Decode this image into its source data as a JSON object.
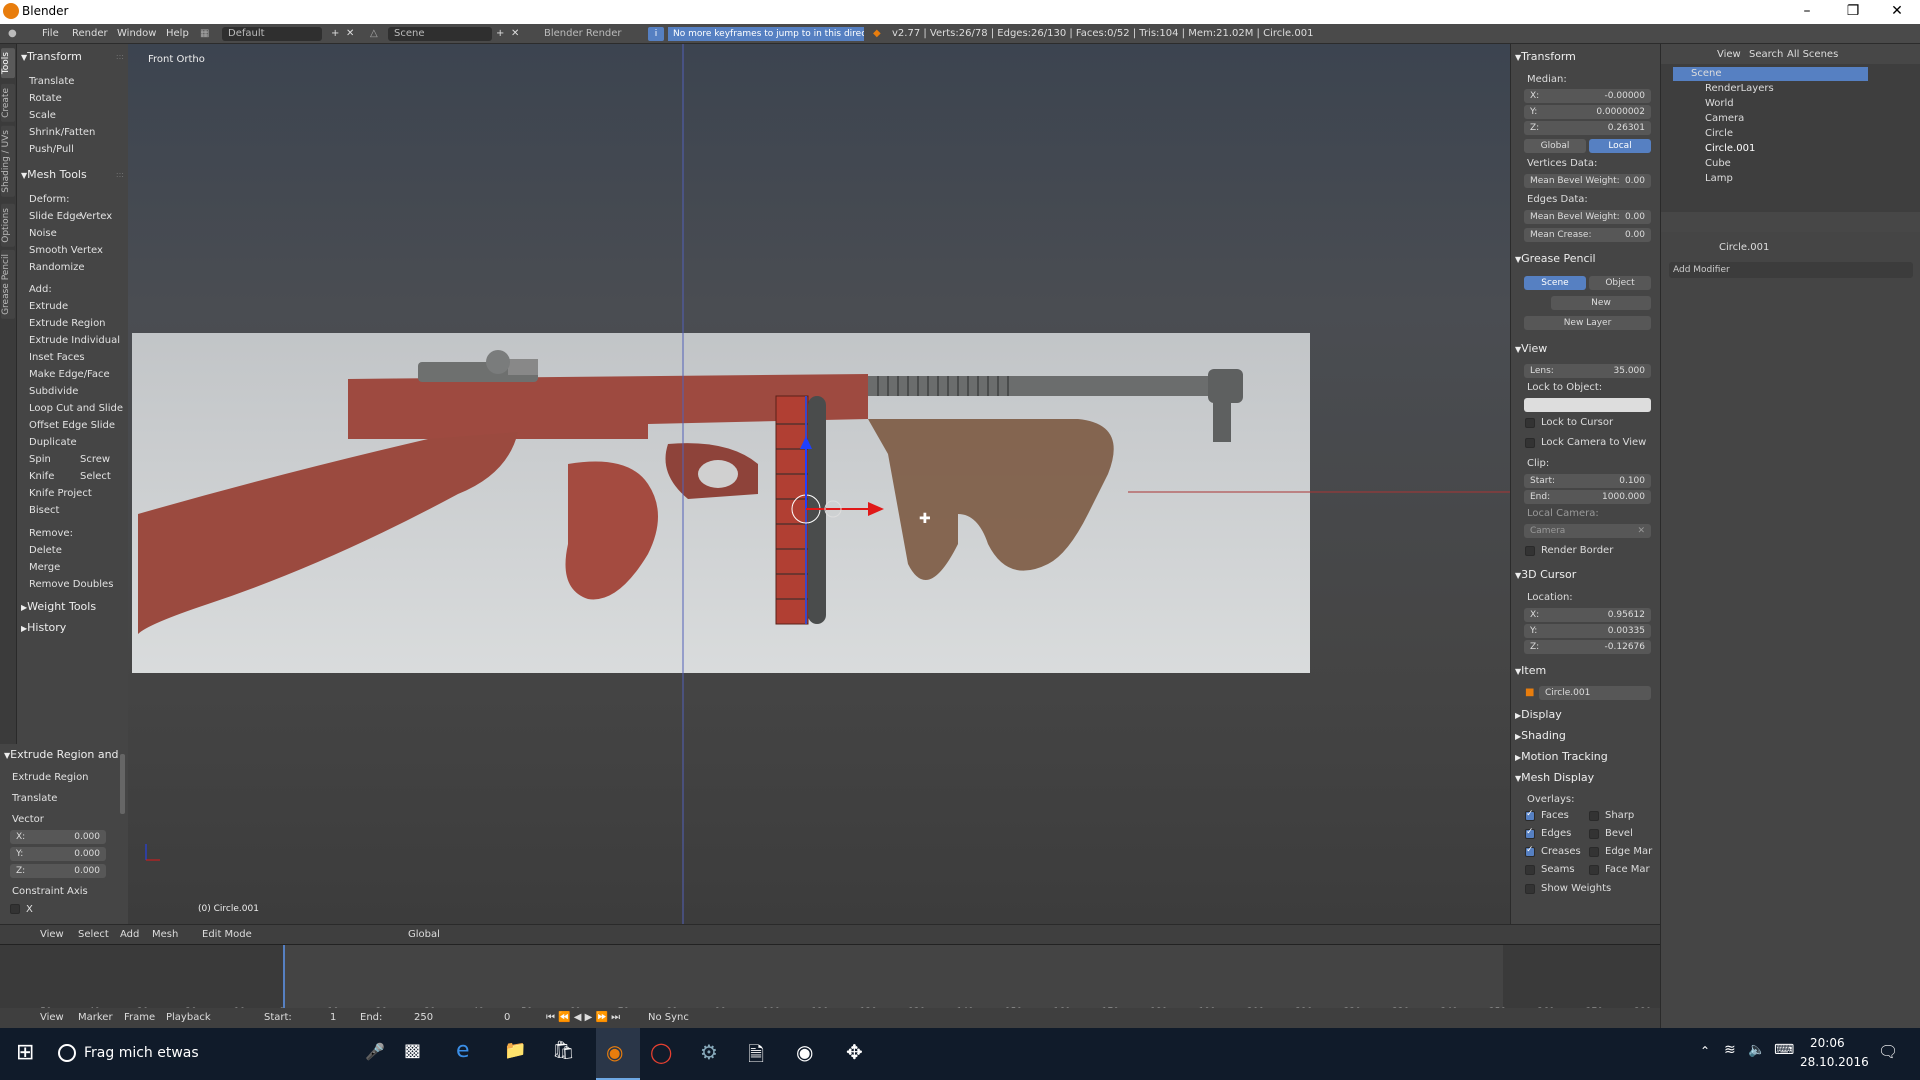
{
  "window": {
    "title": "Blender",
    "controls": [
      "–",
      "❐",
      "✕"
    ]
  },
  "infobar": {
    "menus": [
      "File",
      "Render",
      "Window",
      "Help"
    ],
    "layout": "Default",
    "scene": "Scene",
    "engine": "Blender Render",
    "message": "No more keyframes to jump to in this direction",
    "stats": "v2.77 | Verts:26/78 | Edges:26/130 | Faces:0/52 | Tris:104 | Mem:21.02M | Circle.001"
  },
  "tool_tabs": [
    "Tools",
    "Create",
    "Shading / UVs",
    "Options",
    "Grease Pencil"
  ],
  "toolshelf": {
    "transform_header": "Transform",
    "transform_items": [
      "Translate",
      "Rotate",
      "Scale",
      "Shrink/Fatten",
      "Push/Pull"
    ],
    "mesh_tools_header": "Mesh Tools",
    "deform_label": "Deform:",
    "slide_edge": "Slide Edge",
    "vertex": "Vertex",
    "deform_items": [
      "Noise",
      "Smooth Vertex",
      "Randomize"
    ],
    "add_label": "Add:",
    "add_items": [
      "Extrude",
      "Extrude Region",
      "Extrude Individual",
      "Inset Faces",
      "Make Edge/Face",
      "Subdivide",
      "Loop Cut and Slide",
      "Offset Edge Slide",
      "Duplicate"
    ],
    "spin": "Spin",
    "screw": "Screw",
    "knife": "Knife",
    "select": "Select",
    "knife_project": "Knife Project",
    "bisect": "Bisect",
    "remove_label": "Remove:",
    "remove_items": [
      "Delete",
      "Merge",
      "Remove Doubles"
    ],
    "weight_tools": "Weight Tools",
    "history": "History"
  },
  "operator_panel": {
    "header": "Extrude Region and",
    "op1": "Extrude Region",
    "op2": "Translate",
    "vector_label": "Vector",
    "x_label": "X:",
    "x_val": "0.000",
    "y_label": "Y:",
    "y_val": "0.000",
    "z_label": "Z:",
    "z_val": "0.000",
    "constraint_label": "Constraint Axis",
    "cx": "X"
  },
  "viewport": {
    "view_name": "Front Ortho",
    "object_label": "(0) Circle.001"
  },
  "header": {
    "menus": [
      "View",
      "Select",
      "Add",
      "Mesh"
    ],
    "mode": "Edit Mode",
    "orientation": "Global"
  },
  "timeline": {
    "ticks": [
      "-50",
      "-40",
      "-30",
      "-20",
      "-10",
      "0",
      "10",
      "20",
      "30",
      "40",
      "50",
      "60",
      "70",
      "80",
      "90",
      "100",
      "110",
      "120",
      "130",
      "140",
      "150",
      "160",
      "170",
      "180",
      "190",
      "200",
      "210",
      "220",
      "230",
      "240",
      "250",
      "260",
      "270",
      "280"
    ],
    "menus": [
      "View",
      "Marker",
      "Frame",
      "Playback"
    ],
    "start_label": "Start:",
    "start": "1",
    "end_label": "End:",
    "end": "250",
    "current": "0",
    "sync": "No Sync",
    "current_frame": 0
  },
  "npanel": {
    "transform": "Transform",
    "median": "Median:",
    "x_label": "X:",
    "x": "-0.00000",
    "y_label": "Y:",
    "y": "0.0000002",
    "z_label": "Z:",
    "z": "0.26301",
    "global": "Global",
    "local": "Local",
    "vertices_data": "Vertices Data:",
    "mean_bevel": "Mean Bevel Weight:",
    "mean_bevel_v": "0.00",
    "edges_data": "Edges Data:",
    "mean_bevel2": "Mean Bevel Weight:",
    "mean_bevel2_v": "0.00",
    "mean_crease": "Mean Crease:",
    "mean_crease_v": "0.00",
    "grease_pencil": "Grease Pencil",
    "gp_scene": "Scene",
    "gp_object": "Object",
    "gp_new": "New",
    "gp_new_layer": "New Layer",
    "view": "View",
    "lens_label": "Lens:",
    "lens": "35.000",
    "lock_to_object": "Lock to Object:",
    "lock_to_cursor": "Lock to Cursor",
    "lock_camera": "Lock Camera to View",
    "clip": "Clip:",
    "start_label": "Start:",
    "start": "0.100",
    "end_label": "End:",
    "end": "1000.000",
    "local_camera": "Local Camera:",
    "camera": "Camera",
    "render_border": "Render Border",
    "cursor": "3D Cursor",
    "location": "Location:",
    "cx_label": "X:",
    "cx": "0.95612",
    "cy_label": "Y:",
    "cy": "0.00335",
    "cz_label": "Z:",
    "cz": "-0.12676",
    "item": "Item",
    "item_name": "Circle.001",
    "display": "Display",
    "shading": "Shading",
    "motion_tracking": "Motion Tracking",
    "mesh_display": "Mesh Display",
    "overlays": "Overlays:",
    "faces": "Faces",
    "edges": "Edges",
    "creases": "Creases",
    "seams": "Seams",
    "show_weights": "Show Weights",
    "sharp": "Sharp",
    "bevel": "Bevel",
    "edge_mar": "Edge Mar",
    "face_mar": "Face Mar"
  },
  "outliner": {
    "view": "View",
    "search": "Search",
    "all_scenes": "All Scenes",
    "items": [
      "Scene",
      "RenderLayers",
      "World",
      "Camera",
      "Circle",
      "Circle.001",
      "Cube",
      "Lamp"
    ]
  },
  "properties": {
    "object": "Circle.001",
    "add_modifier": "Add Modifier"
  },
  "taskbar": {
    "search": "Frag mich etwas",
    "time": "20:06",
    "date": "28.10.2016"
  }
}
